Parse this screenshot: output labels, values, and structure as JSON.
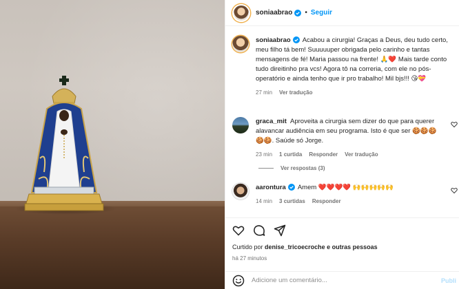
{
  "post": {
    "username": "soniaabrao",
    "separator": "•",
    "follow_label": "Seguir"
  },
  "comments": [
    {
      "username": "soniaabrao",
      "text": "Acabou a cirurgia! Graças a Deus, deu tudo certo, meu filho tá bem! Suuuuuper obrigada pelo carinho e tantas mensagens de fé! Maria passou na frente! 🙏❤️ Mais tarde conto tudo direitinho pra vcs! Agora tô na correria, com ele no pós-operatório e ainda tenho que ir pro trabalho! Mil bjs!!! 😘💝",
      "time": "27 min",
      "translate": "Ver tradução"
    },
    {
      "username": "graca_mit",
      "text": "Aproveita a cirurgia sem dizer do que para querer alavancar audiência em seu programa. Isto é que ser 🍪🍪🍪 🍪🍪. Saúde só Jorge.",
      "time": "23 min",
      "likes": "1 curtida",
      "reply": "Responder",
      "translate": "Ver tradução",
      "view_replies": "Ver respostas (3)"
    },
    {
      "username": "aaronturа",
      "text": "Amem ❤️❤️❤️❤️ 🙌🙌🙌🙌🙌",
      "time": "14 min",
      "likes": "3 curtidas",
      "reply": "Responder"
    }
  ],
  "liked_by": {
    "prefix": "Curtido por",
    "user": "denise_tricoecroche",
    "suffix": "e outras pessoas"
  },
  "timestamp": "há 27 minutos",
  "add_comment": {
    "placeholder": "Adicione um comentário...",
    "publish": "Publi"
  },
  "colors": {
    "accent": "#0095f6",
    "verified": "#0095f6",
    "heart_red": "#ed4956",
    "muted": "#737373"
  }
}
